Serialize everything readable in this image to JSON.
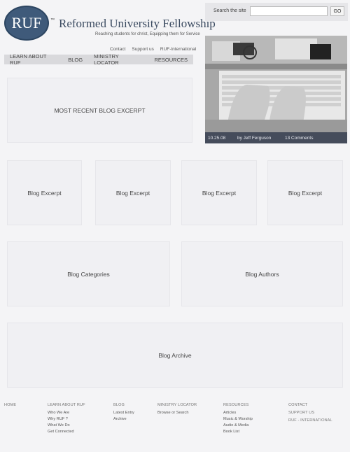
{
  "header": {
    "logo_text": "RUF",
    "trademark": "™",
    "title": "Reformed University Fellowship",
    "tagline": "Reaching students for christ, Equipping them for Service",
    "util_links": [
      "Contact",
      "Support us",
      "RUF-International"
    ]
  },
  "nav": {
    "items": [
      "LEARN ABOUT RUF",
      "BLOG",
      "MINISTRY LOCATOR",
      "RESOURCES"
    ]
  },
  "search": {
    "label": "Search the site",
    "value": "",
    "button": "GO"
  },
  "feature": {
    "date": "10.25.08",
    "author": "by Jeff Ferguson",
    "comments": "13 Comments"
  },
  "main": {
    "recent_excerpt": "MOST RECENT BLOG EXCERPT",
    "excerpts": [
      "Blog Excerpt",
      "Blog Excerpt",
      "Blog Excerpt",
      "Blog Excerpt"
    ],
    "categories": "Blog Categories",
    "authors": "Blog Authors",
    "archive": "Blog Archive"
  },
  "footer": {
    "home": "HOME",
    "learn": {
      "heading": "LEARN ABOUT RUF",
      "links": [
        "Who We Are",
        "Why RUF ?",
        "What We Do",
        "Get Connected"
      ]
    },
    "blog": {
      "heading": "BLOG",
      "links": [
        "Latest Entry",
        "Archive"
      ]
    },
    "locator": {
      "heading": "MINISTRY LOCATOR",
      "links": [
        "Browse or Search"
      ]
    },
    "resources": {
      "heading": "RESOURCES",
      "links": [
        "Articles",
        "Music & Worship",
        "Audio & Media",
        "Book List"
      ]
    },
    "contact": "CONTACT",
    "support": "SUPPORT US",
    "international": "RUF - INTERNATIONAL"
  }
}
